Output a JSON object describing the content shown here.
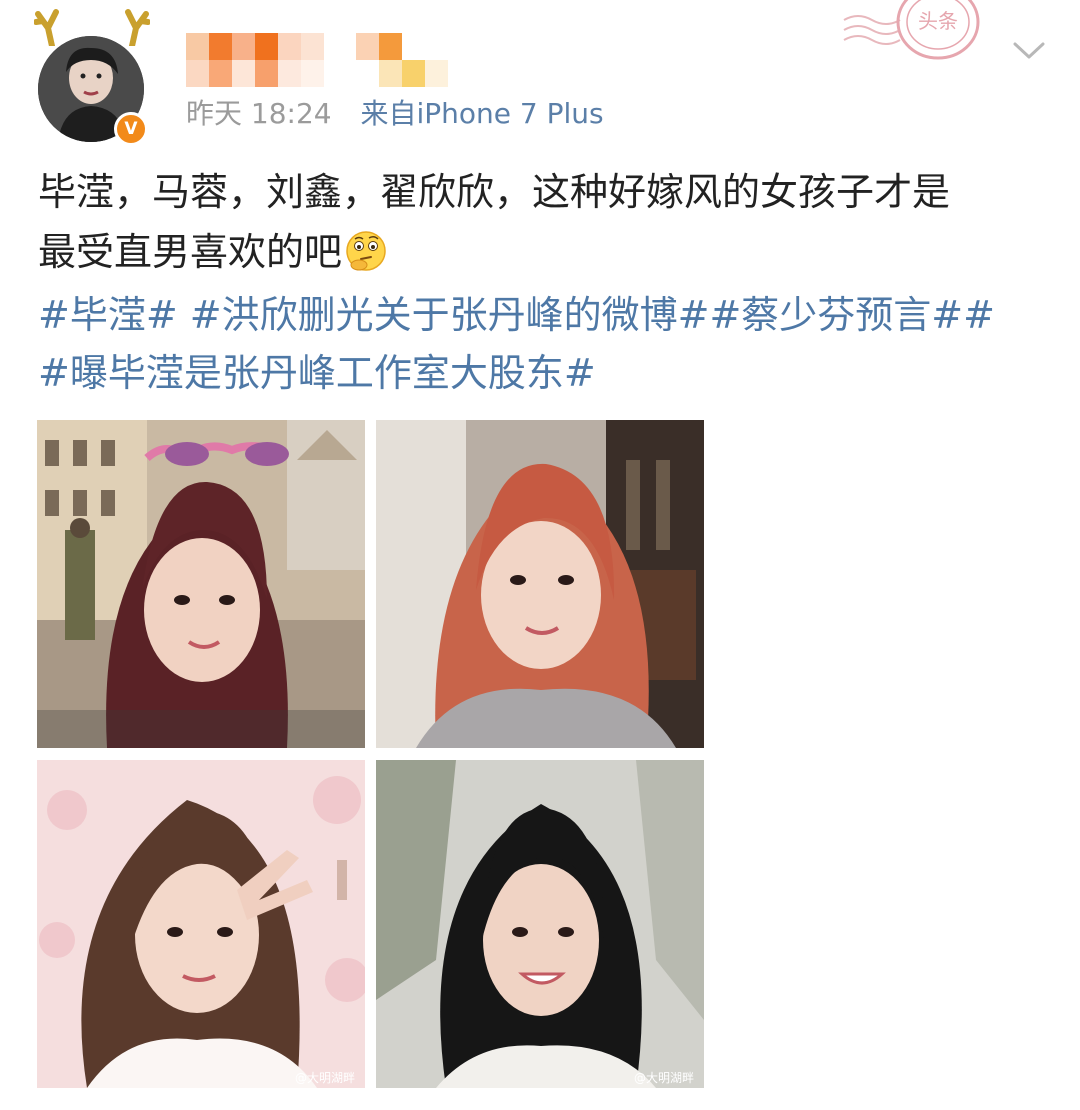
{
  "post": {
    "user": {
      "verified_badge": "V"
    },
    "meta": {
      "time": "昨天 18:24",
      "source": "来自iPhone 7 Plus"
    },
    "content": {
      "line1": "毕滢，马蓉，刘鑫，翟欣欣，这种好嫁风的女孩子才是",
      "line2": "最受直男喜欢的吧",
      "emoji_icon": "thinking-face-icon"
    },
    "hashtags": [
      "#毕滢#",
      "#洪欣删光关于张丹峰的微博#",
      "#蔡少芬预言#",
      "#曝毕滢是张丹峰工作室大股东#"
    ],
    "stamp_text": "头条",
    "photos": [
      {
        "watermark": ""
      },
      {
        "watermark": ""
      },
      {
        "watermark": "@大明湖畔"
      },
      {
        "watermark": "@大明湖畔"
      }
    ],
    "colors": {
      "hashtag": "#4e78a6",
      "meta": "#9b9b9b",
      "badge": "#f28a1a"
    }
  }
}
